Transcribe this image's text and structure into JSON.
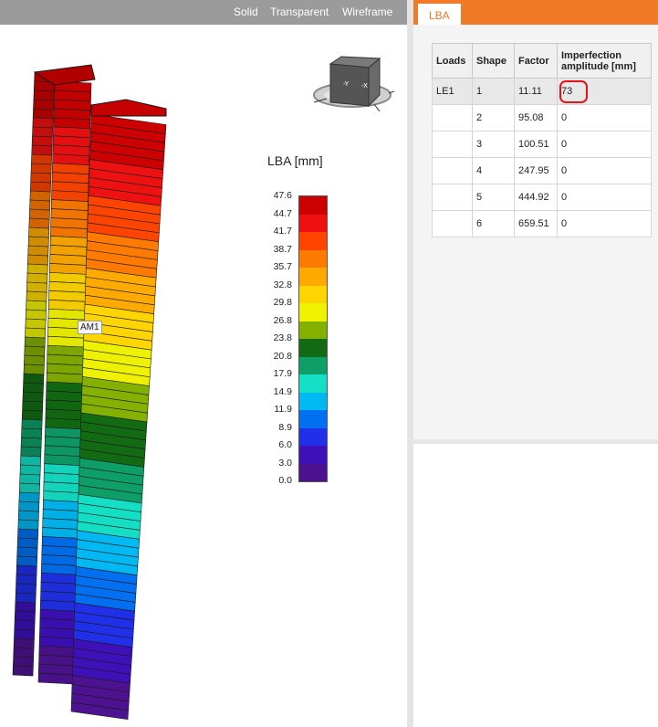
{
  "view": {
    "modes": [
      "Solid",
      "Transparent",
      "Wireframe"
    ],
    "model_label": "AM1"
  },
  "legend": {
    "title": "LBA [mm]",
    "ticks": [
      "47.6",
      "44.7",
      "41.7",
      "38.7",
      "35.7",
      "32.8",
      "29.8",
      "26.8",
      "23.8",
      "20.8",
      "17.9",
      "14.9",
      "11.9",
      "8.9",
      "6.0",
      "3.0",
      "0.0"
    ],
    "colors": [
      "#cc0000",
      "#ee1111",
      "#ff4400",
      "#ff7a00",
      "#ffaa00",
      "#ffd500",
      "#eef200",
      "#84b000",
      "#126b12",
      "#0e9e68",
      "#14dec4",
      "#00b8f2",
      "#0070f0",
      "#2030e8",
      "#3d10b8",
      "#4c128f"
    ]
  },
  "panel": {
    "tab": "LBA",
    "columns": [
      "Loads",
      "Shape",
      "Factor",
      "Imperfection amplitude [mm]"
    ],
    "rows": [
      {
        "loads": "LE1",
        "shape": "1",
        "factor": "11.11",
        "amp": "73"
      },
      {
        "loads": "",
        "shape": "2",
        "factor": "95.08",
        "amp": "0"
      },
      {
        "loads": "",
        "shape": "3",
        "factor": "100.51",
        "amp": "0"
      },
      {
        "loads": "",
        "shape": "4",
        "factor": "247.95",
        "amp": "0"
      },
      {
        "loads": "",
        "shape": "5",
        "factor": "444.92",
        "amp": "0"
      },
      {
        "loads": "",
        "shape": "6",
        "factor": "659.51",
        "amp": "0"
      }
    ]
  }
}
